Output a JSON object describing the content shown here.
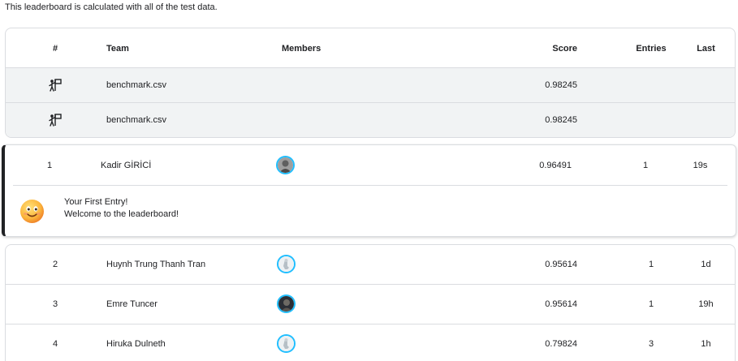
{
  "note": "This leaderboard is calculated with all of the test data.",
  "header": {
    "rank": "#",
    "team": "Team",
    "members": "Members",
    "score": "Score",
    "entries": "Entries",
    "last": "Last"
  },
  "benchmarks": [
    {
      "team": "benchmark.csv",
      "score": "0.98245",
      "icon": "benchmark-icon"
    },
    {
      "team": "benchmark.csv",
      "score": "0.98245",
      "icon": "benchmark-icon"
    }
  ],
  "highlight": {
    "rank": "1",
    "team": "Kadir GİRİCİ",
    "score": "0.96491",
    "entries": "1",
    "last": "19s",
    "message_line1": "Your First Entry!",
    "message_line2": "Welcome to the leaderboard!",
    "icon": "smiley-emoji-icon"
  },
  "rows": [
    {
      "rank": "2",
      "team": "Huynh Trung Thanh Tran",
      "score": "0.95614",
      "entries": "1",
      "last": "1d"
    },
    {
      "rank": "3",
      "team": "Emre Tuncer",
      "score": "0.95614",
      "entries": "1",
      "last": "19h"
    },
    {
      "rank": "4",
      "team": "Hiruka Dulneth",
      "score": "0.79824",
      "entries": "3",
      "last": "1h"
    }
  ],
  "colors": {
    "avatar_ring": "#20beff",
    "benchmark_row_bg": "#f1f3f4",
    "highlight_border": "#202124"
  }
}
